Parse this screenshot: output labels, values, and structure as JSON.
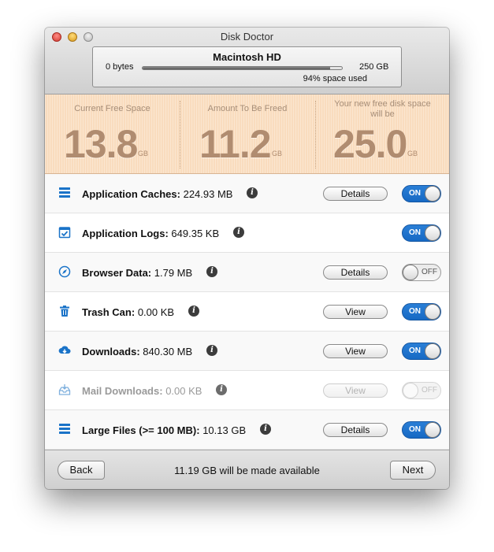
{
  "window": {
    "title": "Disk Doctor"
  },
  "disk": {
    "name": "Macintosh HD",
    "min_label": "0 bytes",
    "max_label": "250 GB",
    "used_percent": 94,
    "used_label": "94% space used"
  },
  "stats": [
    {
      "label": "Current Free Space",
      "value": "13.8",
      "unit": "GB"
    },
    {
      "label": "Amount To Be Freed",
      "value": "11.2",
      "unit": "GB"
    },
    {
      "label": "Your new free disk space will be",
      "value": "25.0",
      "unit": "GB"
    }
  ],
  "rows": [
    {
      "name": "Application Caches:",
      "size": "224.93 MB",
      "icon": "stack-icon",
      "button": "Details",
      "toggle": "ON",
      "enabled": true
    },
    {
      "name": "Application Logs:",
      "size": "649.35 KB",
      "icon": "calendar-check-icon",
      "button": "",
      "toggle": "ON",
      "enabled": true
    },
    {
      "name": "Browser Data:",
      "size": "1.79 MB",
      "icon": "compass-icon",
      "button": "Details",
      "toggle": "OFF",
      "enabled": true
    },
    {
      "name": "Trash Can:",
      "size": "0.00 KB",
      "icon": "trash-icon",
      "button": "View",
      "toggle": "ON",
      "enabled": true
    },
    {
      "name": "Downloads:",
      "size": "840.30 MB",
      "icon": "cloud-download-icon",
      "button": "View",
      "toggle": "ON",
      "enabled": true
    },
    {
      "name": "Mail Downloads:",
      "size": "0.00 KB",
      "icon": "mail-tray-icon",
      "button": "View",
      "toggle": "OFF",
      "enabled": false
    },
    {
      "name": "Large Files (>= 100 MB):",
      "size": "10.13 GB",
      "icon": "stack-icon",
      "button": "Details",
      "toggle": "ON",
      "enabled": true
    }
  ],
  "info_glyph": "i",
  "footer": {
    "back_label": "Back",
    "summary": "11.19 GB will be made available",
    "next_label": "Next"
  },
  "colors": {
    "accent": "#1769c4",
    "stats_bg": "#f9dcbe",
    "stats_text": "#b08c70"
  }
}
